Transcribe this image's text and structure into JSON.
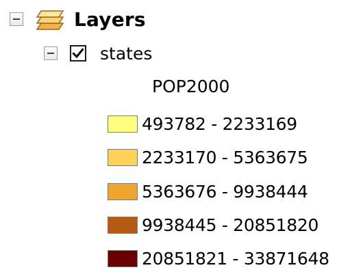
{
  "toc": {
    "group": {
      "icon": "layers-icon",
      "label": "Layers",
      "expanded": true
    },
    "layer": {
      "name": "states",
      "visible": true,
      "expanded": true,
      "field": "POP2000",
      "classes": [
        {
          "label": "493782 - 2233169",
          "color": "#ffff80"
        },
        {
          "label": "2233170 - 5363675",
          "color": "#fdd257"
        },
        {
          "label": "5363676 - 9938444",
          "color": "#f0a531"
        },
        {
          "label": "9938445 - 20851820",
          "color": "#b45a14"
        },
        {
          "label": "20851821 - 33871648",
          "color": "#6a0000"
        }
      ]
    }
  }
}
